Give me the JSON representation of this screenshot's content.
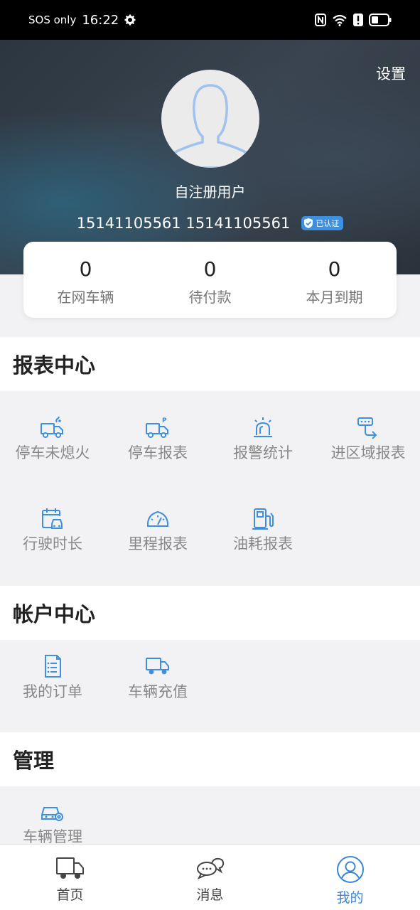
{
  "status_bar": {
    "carrier": "SOS only",
    "time": "16:22"
  },
  "header": {
    "settings_label": "设置",
    "username": "自注册用户",
    "phone": "15141105561 15141105561",
    "verified_label": "已认证"
  },
  "stats": [
    {
      "value": "0",
      "label": "在网车辆"
    },
    {
      "value": "0",
      "label": "待付款"
    },
    {
      "value": "0",
      "label": "本月到期"
    }
  ],
  "sections": {
    "reports": {
      "title": "报表中心",
      "items": [
        {
          "label": "停车未熄火",
          "icon": "truck-smoke-icon"
        },
        {
          "label": "停车报表",
          "icon": "truck-parking-icon"
        },
        {
          "label": "报警统计",
          "icon": "alarm-light-icon"
        },
        {
          "label": "进区域报表",
          "icon": "route-area-icon"
        },
        {
          "label": "行驶时长",
          "icon": "car-calendar-icon"
        },
        {
          "label": "里程报表",
          "icon": "speedometer-icon"
        },
        {
          "label": "油耗报表",
          "icon": "fuel-pump-icon"
        }
      ]
    },
    "account": {
      "title": "帐户中心",
      "items": [
        {
          "label": "我的订单",
          "icon": "order-document-icon"
        },
        {
          "label": "车辆充值",
          "icon": "truck-recharge-icon"
        }
      ]
    },
    "management": {
      "title": "管理",
      "items": [
        {
          "label": "车辆管理",
          "icon": "car-settings-icon"
        }
      ]
    }
  },
  "bottom_nav": [
    {
      "label": "首页",
      "icon": "truck-home-icon"
    },
    {
      "label": "消息",
      "icon": "chat-bubbles-icon"
    },
    {
      "label": "我的",
      "icon": "user-profile-icon",
      "active": true
    }
  ],
  "colors": {
    "accent": "#3a86d6",
    "icon_blue": "#3d8fe0",
    "header_dark": "#2c3640"
  }
}
